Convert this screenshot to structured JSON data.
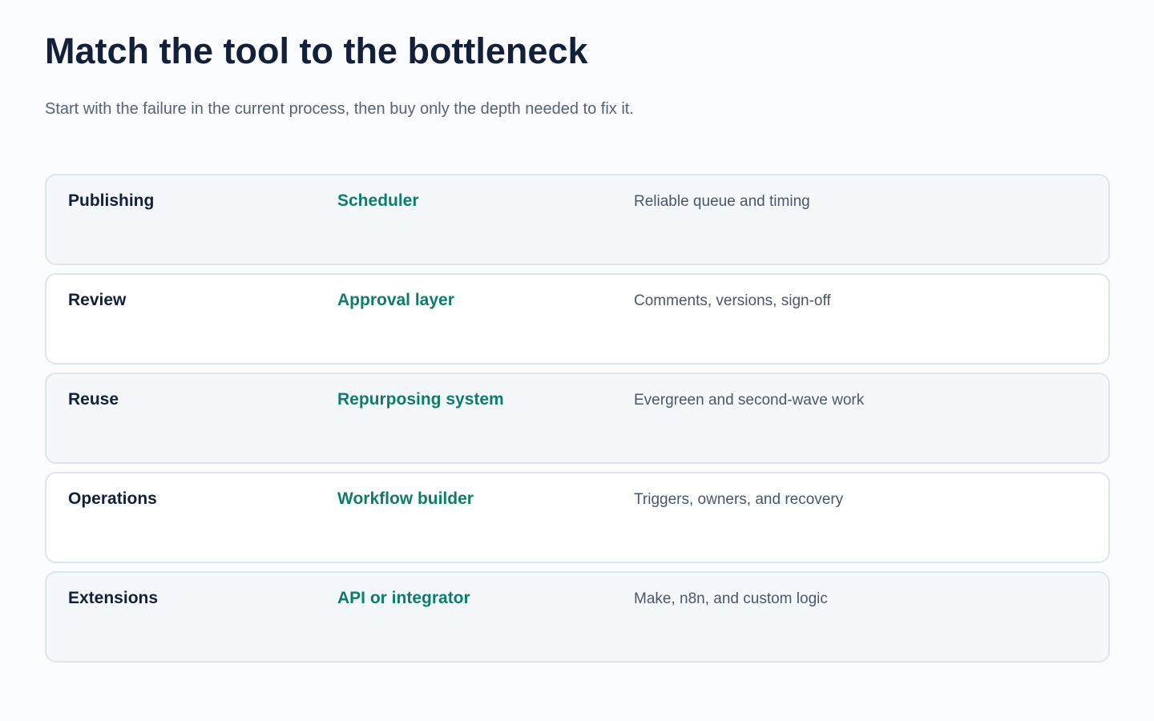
{
  "header": {
    "title": "Match the tool to the bottleneck",
    "subtitle": "Start with the failure in the current process, then buy only the depth needed to fix it."
  },
  "rows": [
    {
      "area": "Publishing",
      "tool": "Scheduler",
      "note": "Reliable queue and timing"
    },
    {
      "area": "Review",
      "tool": "Approval layer",
      "note": "Comments, versions, sign-off"
    },
    {
      "area": "Reuse",
      "tool": "Repurposing system",
      "note": "Evergreen and second-wave work"
    },
    {
      "area": "Operations",
      "tool": "Workflow builder",
      "note": "Triggers, owners, and recovery"
    },
    {
      "area": "Extensions",
      "tool": "API or integrator",
      "note": "Make, n8n, and custom logic"
    }
  ],
  "colors": {
    "title": "#13203a",
    "accent": "#0d7d6b",
    "muted": "#566276",
    "border": "#dde5ee",
    "row_shaded": "#f5f8fb"
  }
}
